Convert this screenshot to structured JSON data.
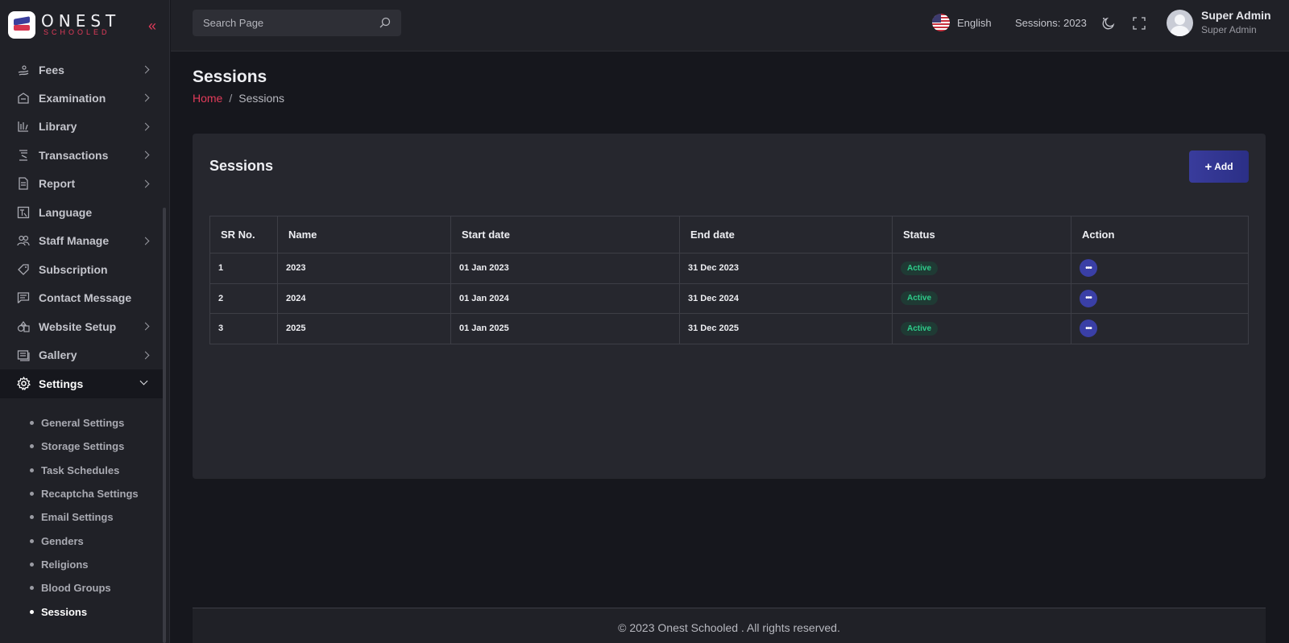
{
  "brand": {
    "title": "ONEST",
    "subtitle": "SCHOOLED"
  },
  "sidebar": {
    "items": [
      {
        "label": "Fees",
        "icon": "fees-icon",
        "has_children": true
      },
      {
        "label": "Examination",
        "icon": "examination-icon",
        "has_children": true
      },
      {
        "label": "Library",
        "icon": "library-icon",
        "has_children": true
      },
      {
        "label": "Transactions",
        "icon": "transactions-icon",
        "has_children": true
      },
      {
        "label": "Report",
        "icon": "report-icon",
        "has_children": true
      },
      {
        "label": "Language",
        "icon": "language-icon",
        "has_children": false
      },
      {
        "label": "Staff Manage",
        "icon": "staff-icon",
        "has_children": true
      },
      {
        "label": "Subscription",
        "icon": "tag-icon",
        "has_children": false
      },
      {
        "label": "Contact Message",
        "icon": "message-icon",
        "has_children": false
      },
      {
        "label": "Website Setup",
        "icon": "website-icon",
        "has_children": true
      },
      {
        "label": "Gallery",
        "icon": "gallery-icon",
        "has_children": true
      },
      {
        "label": "Settings",
        "icon": "gear-icon",
        "has_children": true,
        "active": true
      }
    ],
    "settings_sub": [
      "General Settings",
      "Storage Settings",
      "Task Schedules",
      "Recaptcha Settings",
      "Email Settings",
      "Genders",
      "Religions",
      "Blood Groups",
      "Sessions"
    ],
    "current_sub": "Sessions"
  },
  "header": {
    "search_placeholder": "Search Page",
    "language": "English",
    "session": "Sessions: 2023",
    "user_name": "Super Admin",
    "user_role": "Super Admin"
  },
  "page": {
    "title": "Sessions",
    "breadcrumb_home": "Home",
    "breadcrumb_sep": "/",
    "breadcrumb_current": "Sessions"
  },
  "card": {
    "title": "Sessions",
    "add_label": "Add",
    "columns": [
      "SR No.",
      "Name",
      "Start date",
      "End date",
      "Status",
      "Action"
    ],
    "rows": [
      {
        "sr": "1",
        "name": "2023",
        "start": "01 Jan 2023",
        "end": "31 Dec 2023",
        "status": "Active"
      },
      {
        "sr": "2",
        "name": "2024",
        "start": "01 Jan 2024",
        "end": "31 Dec 2024",
        "status": "Active"
      },
      {
        "sr": "3",
        "name": "2025",
        "start": "01 Jan 2025",
        "end": "31 Dec 2025",
        "status": "Active"
      }
    ]
  },
  "footer": {
    "text": "© 2023 Onest Schooled . All rights reserved."
  },
  "colors": {
    "accent": "#e23b5a",
    "primary": "#393c9c",
    "status_active": "#2ecc8a",
    "background": "#16171d",
    "panel": "#202127"
  }
}
